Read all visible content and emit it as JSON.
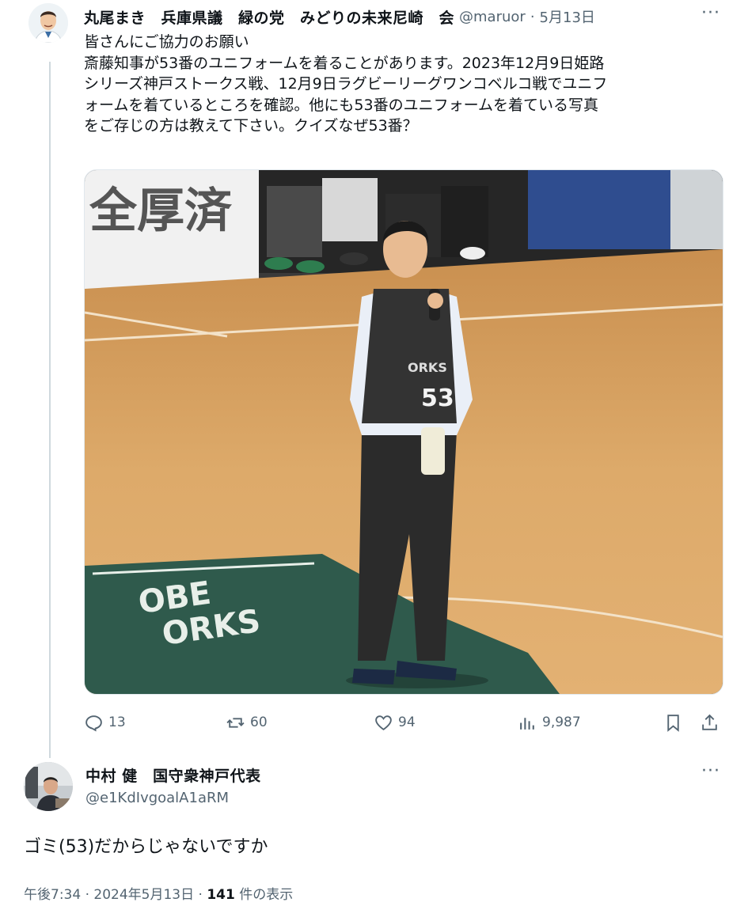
{
  "tweet": {
    "author_name": "丸尾まき　兵庫県議　緑の党　みどりの未来尼崎　会",
    "handle": "@maruor",
    "date": "5月13日",
    "separator": "·",
    "more_icon": "more-horizontal-icon",
    "text_lines": [
      "皆さんにご協力のお願い",
      "斎藤知事が53番のユニフォームを着ることがあります。2023年12月9日姫路",
      "シリーズ神戸ストークス戦、12月9日ラグビーリーグワンコベルコ戦でユニフ",
      "ォームを着ているところを確認。他にも53番のユニフォームを着ている写真",
      "をご存じの方は教えて下さい。クイズなぜ53番？"
    ],
    "photo": {
      "banner_text": "全厚済",
      "jersey_text": "ORKS",
      "jersey_number": "53",
      "court_logo_line1": "OBE",
      "court_logo_line2": "ORKS"
    },
    "actions": {
      "replies": "13",
      "reposts": "60",
      "likes": "94",
      "views": "9,987"
    },
    "icons": [
      "reply-icon",
      "repost-icon",
      "like-icon",
      "views-icon",
      "bookmark-icon",
      "share-icon"
    ]
  },
  "reply": {
    "author_name": "中村 健　国守衆神戸代表",
    "handle": "@e1KdIvgoalA1aRM",
    "text": "ゴミ(53)だからじゃないですか",
    "time": "午後7:34 · 2024年5月13日 · ",
    "views_count": "141",
    "views_label": " 件の表示"
  },
  "colors": {
    "text": "#0f1419",
    "secondary": "#536471",
    "border": "#cfd9de",
    "court_wood": "#d9a566",
    "court_logo": "#2f5a4c"
  }
}
